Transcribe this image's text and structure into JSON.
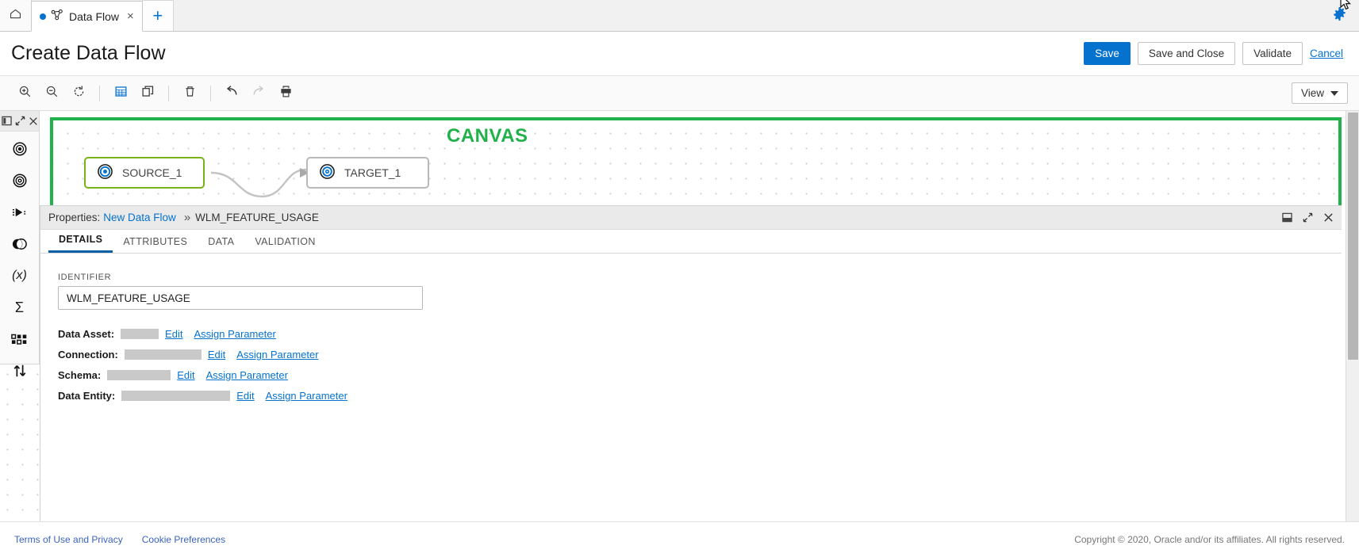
{
  "tabstrip": {
    "home_icon": "home-icon",
    "document_tab": {
      "label": "Data Flow",
      "icon": "data-flow-icon",
      "close": "×",
      "modified_dot": true
    },
    "add_tab_label": "+",
    "settings_icon": "gear-icon"
  },
  "header": {
    "title": "Create Data Flow",
    "save_label": "Save",
    "save_close_label": "Save and Close",
    "validate_label": "Validate",
    "cancel_label": "Cancel",
    "primary_color": "#0572ce"
  },
  "toolbar": {
    "items": [
      {
        "name": "zoom-in-icon",
        "title": "Zoom In"
      },
      {
        "name": "zoom-out-icon",
        "title": "Zoom Out"
      },
      {
        "name": "reset-zoom-icon",
        "title": "Reset"
      },
      {
        "name": "grid-icon",
        "title": "Grid",
        "state": "active"
      },
      {
        "name": "duplicate-icon",
        "title": "Duplicate"
      },
      {
        "name": "delete-icon",
        "title": "Delete"
      },
      {
        "name": "undo-icon",
        "title": "Undo"
      },
      {
        "name": "redo-icon",
        "title": "Redo",
        "state": "disabled"
      },
      {
        "name": "print-icon",
        "title": "Print"
      }
    ],
    "view_label": "View"
  },
  "canvas": {
    "annotation": "CANVAS",
    "annotation_color": "#21b14b",
    "nodes": [
      {
        "label": "SOURCE_1",
        "type": "source",
        "selected": true
      },
      {
        "label": "TARGET_1",
        "type": "target",
        "selected": false
      }
    ]
  },
  "rail": {
    "header_icons": [
      "panel-toggle-icon",
      "expand-icon",
      "close-icon"
    ],
    "items": [
      {
        "name": "source-operator-icon",
        "label": "Source"
      },
      {
        "name": "target-operator-icon",
        "label": "Target"
      },
      {
        "name": "filter-operator-icon",
        "label": "Filter"
      },
      {
        "name": "join-operator-icon",
        "label": "Join"
      },
      {
        "name": "expression-operator-icon",
        "label": "Expression"
      },
      {
        "name": "aggregate-operator-icon",
        "label": "Aggregate"
      },
      {
        "name": "distinct-operator-icon",
        "label": "Distinct"
      },
      {
        "name": "sort-operator-icon",
        "label": "Sort"
      }
    ]
  },
  "properties": {
    "title_prefix": "Properties:",
    "breadcrumb_link": "New Data Flow",
    "breadcrumb_separator": "»",
    "breadcrumb_current": "WLM_FEATURE_USAGE",
    "controls": [
      "restore-icon",
      "expand-icon",
      "close-icon"
    ],
    "tabs": [
      {
        "label": "DETAILS",
        "active": true
      },
      {
        "label": "ATTRIBUTES",
        "active": false
      },
      {
        "label": "DATA",
        "active": false
      },
      {
        "label": "VALIDATION",
        "active": false
      }
    ],
    "identifier_label": "IDENTIFIER",
    "identifier_value": "WLM_FEATURE_USAGE",
    "identifier_placeholder": "Identifier",
    "rows": [
      {
        "key": "Data Asset:",
        "value": "",
        "redacted_width": 48,
        "edit": "Edit",
        "assign": "Assign Parameter"
      },
      {
        "key": "Connection:",
        "value": "",
        "redacted_width": 97,
        "edit": "Edit",
        "assign": "Assign Parameter"
      },
      {
        "key": "Schema:",
        "value": "",
        "redacted_width": 80,
        "edit": "Edit",
        "assign": "Assign Parameter"
      },
      {
        "key": "Data Entity:",
        "value": "",
        "redacted_width": 137,
        "edit": "Edit",
        "assign": "Assign Parameter"
      }
    ]
  },
  "footer": {
    "terms_label": "Terms of Use and Privacy",
    "cookie_label": "Cookie Preferences",
    "copyright": "Copyright © 2020, Oracle and/or its affiliates. All rights reserved."
  }
}
